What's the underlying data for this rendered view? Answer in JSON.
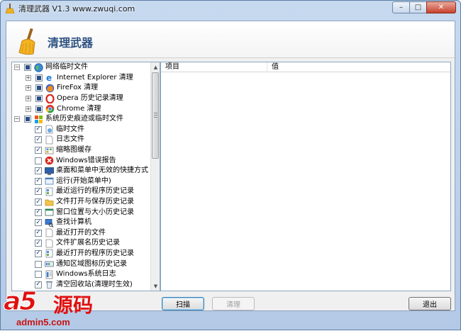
{
  "window": {
    "title": "清理武器 V1.3 www.zwuqi.com",
    "controls": {
      "minimize": "–",
      "maximize": "□",
      "close": "✕"
    }
  },
  "header": {
    "app_name": "清理武器",
    "icon": "broom-icon"
  },
  "tree": {
    "items": [
      {
        "label": "网络临时文件",
        "level": 0,
        "expander": "−",
        "checked": "partial",
        "icon": "globe-icon"
      },
      {
        "label": "Internet Explorer 清理",
        "level": 1,
        "expander": "+",
        "checked": "partial",
        "icon": "ie-icon"
      },
      {
        "label": "FireFox 清理",
        "level": 1,
        "expander": "+",
        "checked": "partial",
        "icon": "firefox-icon"
      },
      {
        "label": "Opera 历史记录清理",
        "level": 1,
        "expander": "+",
        "checked": "partial",
        "icon": "opera-icon"
      },
      {
        "label": "Chrome 清理",
        "level": 1,
        "expander": "+",
        "checked": "partial",
        "icon": "chrome-icon"
      },
      {
        "label": "系统历史痕迹或临时文件",
        "level": 0,
        "expander": "−",
        "checked": "partial",
        "icon": "windows-icon"
      },
      {
        "label": "临时文件",
        "level": 2,
        "checked": "true",
        "icon": "temp-file-icon"
      },
      {
        "label": "日志文件",
        "level": 2,
        "checked": "true",
        "icon": "document-icon"
      },
      {
        "label": "缩略图缓存",
        "level": 2,
        "checked": "true",
        "icon": "thumbnail-icon"
      },
      {
        "label": "Windows错误报告",
        "level": 2,
        "checked": "false",
        "icon": "error-icon"
      },
      {
        "label": "桌面和菜单中无效的快捷方式",
        "level": 2,
        "checked": "true",
        "icon": "desktop-icon"
      },
      {
        "label": "运行(开始菜单中)",
        "level": 2,
        "checked": "true",
        "icon": "run-icon"
      },
      {
        "label": "最近运行的程序历史记录",
        "level": 2,
        "checked": "true",
        "icon": "program-icon"
      },
      {
        "label": "文件打开与保存历史记录",
        "level": 2,
        "checked": "true",
        "icon": "folder-icon"
      },
      {
        "label": "窗口位置与大小历史记录",
        "level": 2,
        "checked": "true",
        "icon": "window-icon"
      },
      {
        "label": "查找计算机",
        "level": 2,
        "checked": "true",
        "icon": "find-computer-icon"
      },
      {
        "label": "最近打开的文件",
        "level": 2,
        "checked": "true",
        "icon": "document-icon"
      },
      {
        "label": "文件扩展名历史记录",
        "level": 2,
        "checked": "true",
        "icon": "document-icon"
      },
      {
        "label": "最近打开的程序历史记录",
        "level": 2,
        "checked": "true",
        "icon": "program-icon"
      },
      {
        "label": "通知区域图标历史记录",
        "level": 2,
        "checked": "false",
        "icon": "tray-icon"
      },
      {
        "label": "Windows系统日志",
        "level": 2,
        "checked": "false",
        "icon": "log-icon"
      },
      {
        "label": "清空回收站(清理时生效)",
        "level": 2,
        "checked": "true",
        "icon": "recycle-bin-icon"
      }
    ]
  },
  "list": {
    "columns": [
      "项目",
      "值"
    ]
  },
  "buttons": {
    "scan": "扫描",
    "clean": "清理",
    "exit": "退出"
  },
  "watermark": {
    "logo_text": "a5源码",
    "url": "admin5.com"
  },
  "colors": {
    "title_text": "#2d5182",
    "accent": "#3c7fb1",
    "watermark": "#e01010"
  }
}
